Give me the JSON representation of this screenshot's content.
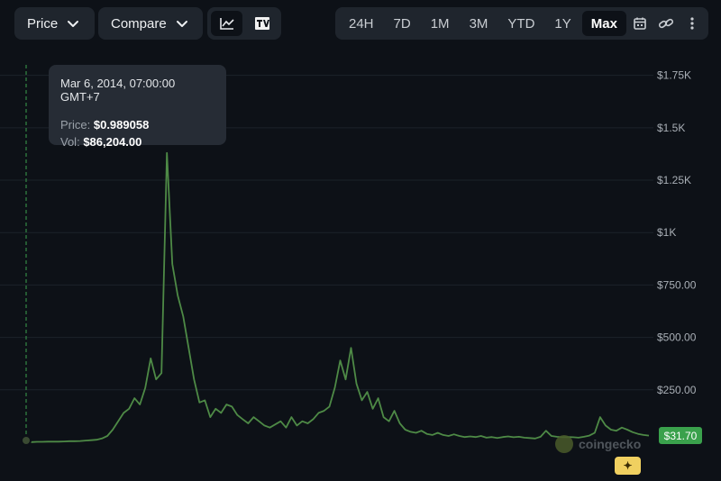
{
  "toolbar": {
    "price_dropdown": "Price",
    "compare_dropdown": "Compare",
    "chart_type_icons": [
      "line-chart-icon",
      "tradingview-icon"
    ],
    "ranges": [
      "24H",
      "7D",
      "1M",
      "3M",
      "YTD",
      "1Y",
      "Max"
    ],
    "active_range": "Max",
    "tool_icons": [
      "calendar-icon",
      "link-icon",
      "more-vertical-icon"
    ]
  },
  "tooltip": {
    "date": "Mar 6, 2014, 07:00:00 GMT+7",
    "price_label": "Price:",
    "price_value": "$0.989058",
    "vol_label": "Vol:",
    "vol_value": "$86,204.00"
  },
  "current_price": "$31.70",
  "watermark": "coingecko",
  "colors": {
    "background": "#0d1117",
    "line": "#4e8a46",
    "price_badge": "#3aa14c",
    "ai_badge": "#f0d060"
  },
  "chart_data": {
    "type": "line",
    "xlabel": "",
    "ylabel": "",
    "ylim": [
      0,
      1830
    ],
    "ytick_labels": [
      "$250.00",
      "$500.00",
      "$750.00",
      "$1K",
      "$1.25K",
      "$1.5K",
      "$1.75K"
    ],
    "ytick_values": [
      250,
      500,
      750,
      1000,
      1250,
      1500,
      1750
    ],
    "grid": true,
    "legend": "none",
    "series": [
      {
        "values": [
          1,
          1,
          2,
          2,
          3,
          3,
          3,
          4,
          5,
          5,
          6,
          8,
          10,
          12,
          18,
          30,
          60,
          100,
          140,
          160,
          210,
          180,
          260,
          400,
          300,
          330,
          1380,
          850,
          700,
          600,
          450,
          300,
          190,
          200,
          120,
          160,
          140,
          180,
          170,
          130,
          110,
          90,
          120,
          100,
          80,
          70,
          85,
          100,
          70,
          120,
          80,
          100,
          90,
          110,
          140,
          150,
          170,
          260,
          390,
          300,
          450,
          280,
          200,
          240,
          160,
          210,
          120,
          100,
          150,
          90,
          60,
          50,
          45,
          55,
          40,
          35,
          45,
          35,
          30,
          38,
          30,
          25,
          28,
          25,
          30,
          22,
          25,
          20,
          25,
          28,
          24,
          26,
          22,
          20,
          18,
          26,
          55,
          30,
          26,
          24,
          25,
          24,
          22,
          26,
          32,
          45,
          120,
          80,
          60,
          55,
          70,
          60,
          48,
          40,
          35,
          32
        ]
      }
    ]
  }
}
